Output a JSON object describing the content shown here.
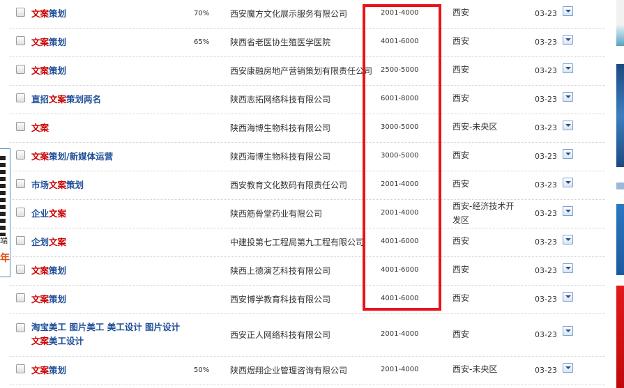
{
  "left_ad": {
    "small_text": "端",
    "accent_text": "年"
  },
  "job_list": [
    {
      "title_parts": [
        {
          "t": "文案",
          "hl": true
        },
        {
          "t": "策划",
          "hl": false
        }
      ],
      "match": "70%",
      "company": "西安魔方文化展示服务有限公司",
      "salary": "2001-4000",
      "location": "西安",
      "date": "03-23"
    },
    {
      "title_parts": [
        {
          "t": "文案",
          "hl": true
        },
        {
          "t": "策划",
          "hl": false
        }
      ],
      "match": "65%",
      "company": "陕西省老医协生殖医学医院",
      "salary": "4001-6000",
      "location": "西安",
      "date": "03-23"
    },
    {
      "title_parts": [
        {
          "t": "文案",
          "hl": true
        },
        {
          "t": "策划",
          "hl": false
        }
      ],
      "match": "",
      "company": "西安康融房地产营销策划有限责任公司",
      "salary": "2500-5000",
      "location": "西安",
      "date": "03-23"
    },
    {
      "title_parts": [
        {
          "t": "直招",
          "hl": false
        },
        {
          "t": "文案",
          "hl": true
        },
        {
          "t": "策划两名",
          "hl": false
        }
      ],
      "match": "",
      "company": "陕西志拓网络科技有限公司",
      "salary": "6001-8000",
      "location": "西安",
      "date": "03-23"
    },
    {
      "title_parts": [
        {
          "t": "文案",
          "hl": true
        }
      ],
      "match": "",
      "company": "陕西海博生物科技有限公司",
      "salary": "3000-5000",
      "location": "西安-未央区",
      "date": "03-23"
    },
    {
      "title_parts": [
        {
          "t": "文案",
          "hl": true
        },
        {
          "t": "策划/新媒体运营",
          "hl": false
        }
      ],
      "match": "",
      "company": "陕西海博生物科技有限公司",
      "salary": "3000-5000",
      "location": "西安",
      "date": "03-23"
    },
    {
      "title_parts": [
        {
          "t": "市场",
          "hl": false
        },
        {
          "t": "文案",
          "hl": true
        },
        {
          "t": "策划",
          "hl": false
        }
      ],
      "match": "",
      "company": "西安教育文化数码有限责任公司",
      "salary": "2001-4000",
      "location": "西安",
      "date": "03-23"
    },
    {
      "title_parts": [
        {
          "t": "企业",
          "hl": false
        },
        {
          "t": "文案",
          "hl": true
        }
      ],
      "match": "",
      "company": "陕西筋骨堂药业有限公司",
      "salary": "2001-4000",
      "location": "西安-经济技术开发区",
      "date": "03-23"
    },
    {
      "title_parts": [
        {
          "t": "企划",
          "hl": false
        },
        {
          "t": "文案",
          "hl": true
        }
      ],
      "match": "",
      "company": "中建投第七工程局第九工程有限公司",
      "salary": "4001-6000",
      "location": "西安",
      "date": "03-23"
    },
    {
      "title_parts": [
        {
          "t": "文案",
          "hl": true
        },
        {
          "t": "策划",
          "hl": false
        }
      ],
      "match": "",
      "company": "陕西上德演艺科技有限公司",
      "salary": "4001-6000",
      "location": "西安",
      "date": "03-23"
    },
    {
      "title_parts": [
        {
          "t": "文案",
          "hl": true
        },
        {
          "t": "策划",
          "hl": false
        }
      ],
      "match": "",
      "company": "西安博学教育科技有限公司",
      "salary": "4001-6000",
      "location": "西安",
      "date": "03-23"
    },
    {
      "title_lines": [
        [
          {
            "t": "淘宝美工 图片美工 美工设计 图片设计",
            "hl": false
          }
        ],
        [
          {
            "t": "文案",
            "hl": true
          },
          {
            "t": "美工设计",
            "hl": false
          }
        ]
      ],
      "match": "",
      "company": "西安正人网络科技有限公司",
      "salary": "2001-4000",
      "location": "西安",
      "date": "03-23"
    },
    {
      "title_parts": [
        {
          "t": "文案",
          "hl": true
        },
        {
          "t": "策划",
          "hl": false
        }
      ],
      "match": "50%",
      "company": "陕西煜翔企业管理咨询有限公司",
      "salary": "2001-4000",
      "location": "西安-未央区",
      "date": "03-23"
    }
  ],
  "colors": {
    "highlight_box": "#e8141a",
    "title_link": "#1f4e99",
    "keyword_highlight": "#cc0000"
  }
}
